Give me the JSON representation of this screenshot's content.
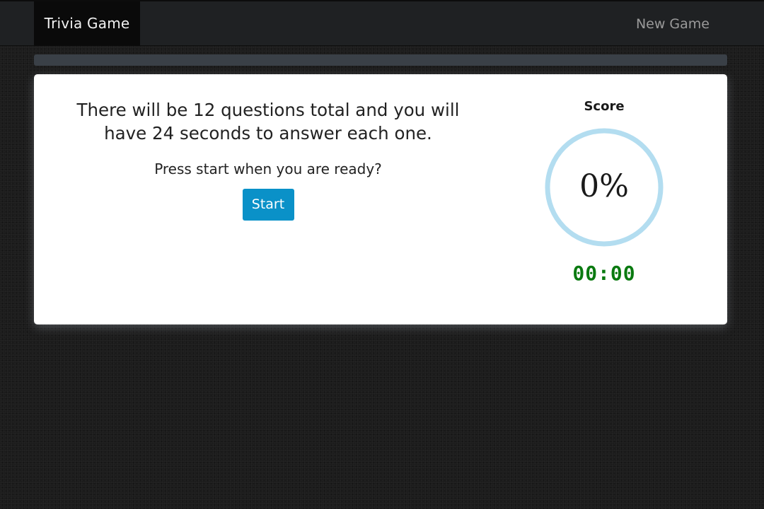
{
  "navbar": {
    "brand": "Trivia Game",
    "new_game_label": "New Game"
  },
  "progress": {
    "value_percent": 0
  },
  "intro": {
    "main_text": "There will be 12 questions total and you will have 24 seconds to answer each one.",
    "sub_text": "Press start when you are ready?",
    "start_label": "Start"
  },
  "score": {
    "label": "Score",
    "value": "0%",
    "timer": "00:00"
  },
  "colors": {
    "accent": "#0a91c8",
    "ring": "#b3ddf0",
    "timer": "#0a7a10",
    "navbar": "#1f2123",
    "brand_bg": "#0a0a0a"
  }
}
